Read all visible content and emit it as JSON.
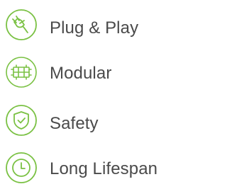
{
  "accent_color": "#7ac143",
  "text_color": "#4a4a4a",
  "features": [
    {
      "label": "Plug & Play",
      "icon": "plug-icon"
    },
    {
      "label": "Modular",
      "icon": "modular-icon"
    },
    {
      "label": "Safety",
      "icon": "shield-icon"
    },
    {
      "label": "Long Lifespan",
      "icon": "clock-icon"
    }
  ]
}
